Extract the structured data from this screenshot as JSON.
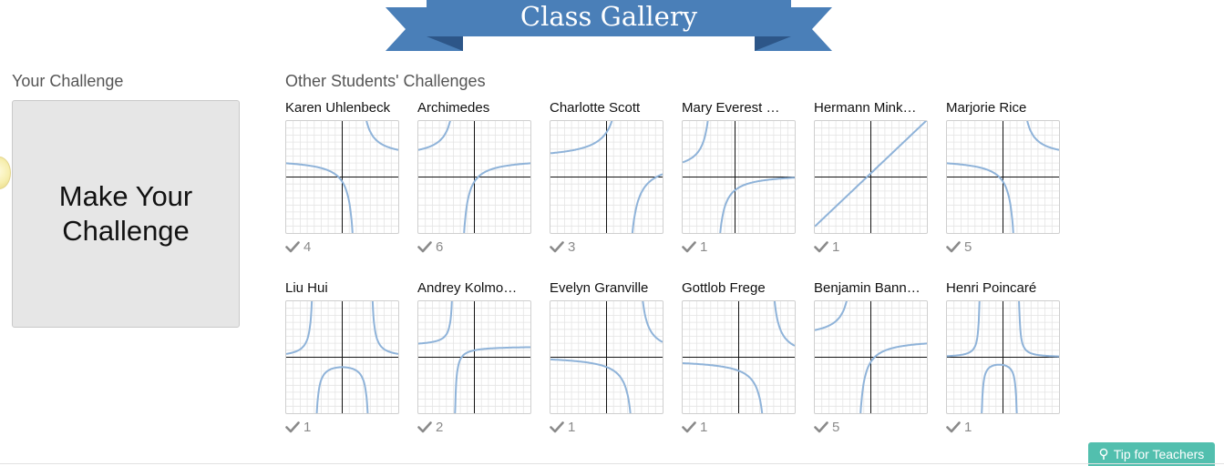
{
  "banner": {
    "title": "Class Gallery",
    "color": "#4a7fb8",
    "dark": "#36659b"
  },
  "your_challenge": {
    "heading": "Your Challenge",
    "make_label_line1": "Make Your",
    "make_label_line2": "Challenge"
  },
  "others": {
    "heading": "Other Students' Challenges",
    "cards": [
      {
        "name": "Karen Uhlenbeck",
        "votes": "4",
        "graph": "a"
      },
      {
        "name": "Archimedes",
        "votes": "6",
        "graph": "b"
      },
      {
        "name": "Charlotte Scott",
        "votes": "3",
        "graph": "c"
      },
      {
        "name": "Mary Everest …",
        "votes": "1",
        "graph": "d"
      },
      {
        "name": "Hermann Mink…",
        "votes": "1",
        "graph": "line"
      },
      {
        "name": "Marjorie Rice",
        "votes": "5",
        "graph": "a"
      },
      {
        "name": "Liu Hui",
        "votes": "1",
        "graph": "e"
      },
      {
        "name": "Andrey Kolmo…",
        "votes": "2",
        "graph": "f"
      },
      {
        "name": "Evelyn Granville",
        "votes": "1",
        "graph": "g"
      },
      {
        "name": "Gottlob Frege",
        "votes": "1",
        "graph": "h"
      },
      {
        "name": "Benjamin Bann…",
        "votes": "5",
        "graph": "b"
      },
      {
        "name": "Henri Poincaré",
        "votes": "1",
        "graph": "i"
      }
    ]
  },
  "tip": {
    "label": "Tip for Teachers",
    "icon": "lightbulb-icon"
  },
  "colors": {
    "curve": "#8fb3d9",
    "axis": "#111111",
    "grid": "#e4e4e4",
    "tip": "#52bfae"
  }
}
